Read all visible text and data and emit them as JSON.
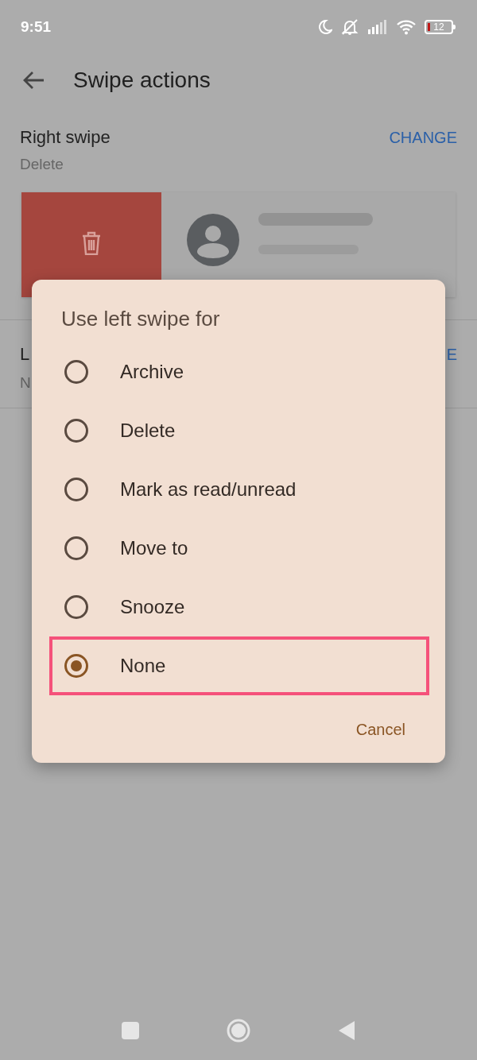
{
  "status_bar": {
    "time": "9:51",
    "battery": "12"
  },
  "header": {
    "title": "Swipe actions"
  },
  "right_swipe": {
    "label": "Right swipe",
    "value": "Delete",
    "action": "CHANGE"
  },
  "left_swipe": {
    "label": "L",
    "value": "N",
    "action": "E"
  },
  "dialog": {
    "title": "Use left swipe for",
    "options": [
      {
        "label": "Archive",
        "selected": false,
        "highlighted": false
      },
      {
        "label": "Delete",
        "selected": false,
        "highlighted": false
      },
      {
        "label": "Mark as read/unread",
        "selected": false,
        "highlighted": false
      },
      {
        "label": "Move to",
        "selected": false,
        "highlighted": false
      },
      {
        "label": "Snooze",
        "selected": false,
        "highlighted": false
      },
      {
        "label": "None",
        "selected": true,
        "highlighted": true
      }
    ],
    "cancel": "Cancel"
  }
}
